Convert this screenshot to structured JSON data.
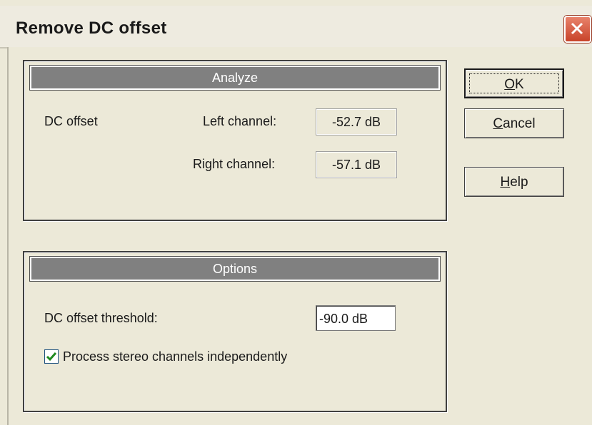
{
  "window": {
    "title": "Remove DC offset"
  },
  "analyze": {
    "header": "Analyze",
    "dc_offset_label": "DC offset",
    "left_label": "Left channel:",
    "left_value": "-52.7 dB",
    "right_label": "Right channel:",
    "right_value": "-57.1 dB"
  },
  "options": {
    "header": "Options",
    "threshold_label": "DC offset threshold:",
    "threshold_value": "-90.0 dB",
    "stereo_checkbox_label": "Process stereo channels independently",
    "stereo_checked": true
  },
  "buttons": {
    "ok": {
      "mnemonic": "O",
      "rest": "K"
    },
    "cancel": {
      "mnemonic": "C",
      "rest": "ancel"
    },
    "help": {
      "mnemonic": "H",
      "rest": "elp"
    }
  },
  "icons": {
    "close": "close-icon",
    "check": "checkmark-icon"
  },
  "colors": {
    "close_button": "#d0553a",
    "checkmark": "#1f8a1f",
    "group_header": "#808080"
  }
}
